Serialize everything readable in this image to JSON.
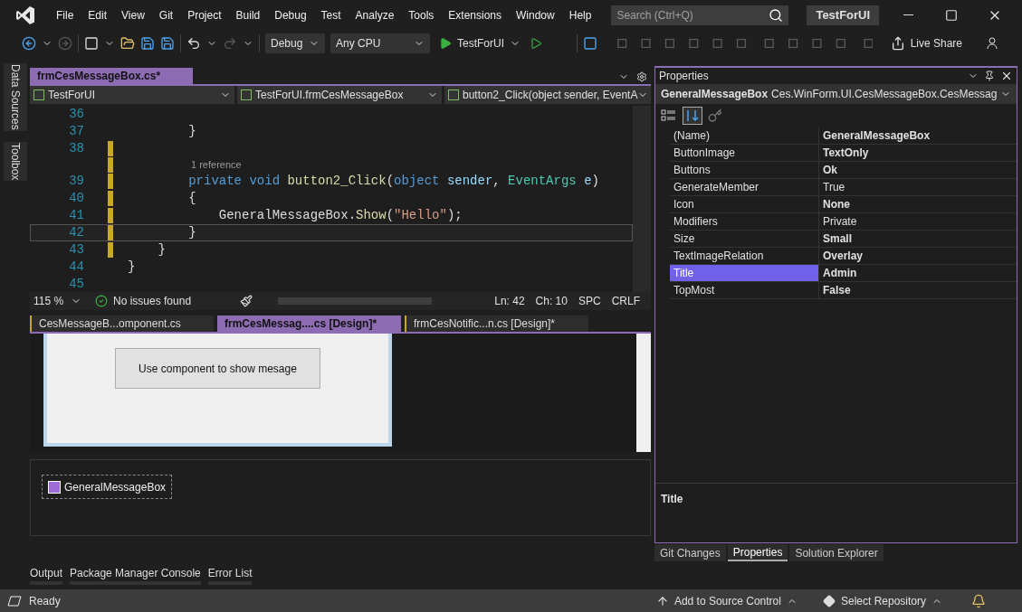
{
  "menu": [
    "File",
    "Edit",
    "View",
    "Git",
    "Project",
    "Build",
    "Debug",
    "Test",
    "Analyze",
    "Tools",
    "Extensions",
    "Window",
    "Help"
  ],
  "search": {
    "placeholder": "Search (Ctrl+Q)"
  },
  "solution_badge": "TestForUI",
  "toolbar": {
    "configuration": "Debug",
    "platform": "Any CPU",
    "start": "TestForUI",
    "live_share": "Live Share"
  },
  "side_tabs": [
    "Data Sources",
    "Toolbox"
  ],
  "editor_tabs": [
    {
      "label": "frmCesMessageBox.cs*",
      "selected": true
    }
  ],
  "nav_bar": [
    "TestForUI",
    "TestForUI.frmCesMessageBox",
    "button2_Click(object sender, EventA"
  ],
  "code_lines": [
    {
      "kind": "line",
      "number": "36",
      "modified": false,
      "current": false
    },
    {
      "kind": "line",
      "number": "37",
      "modified": false,
      "current": false,
      "tokens": [
        {
          "kind": "plain",
          "text": "        }"
        }
      ]
    },
    {
      "kind": "line",
      "number": "38",
      "modified": true,
      "current": false
    },
    {
      "kind": "codelens",
      "text": "1 reference",
      "modified": true
    },
    {
      "kind": "line",
      "number": "39",
      "modified": true,
      "current": false,
      "tokens": [
        {
          "kind": "keyword",
          "text": "        private void "
        },
        {
          "kind": "method",
          "text": "button2_Click"
        },
        {
          "kind": "plain",
          "text": "("
        },
        {
          "kind": "keyword",
          "text": "object "
        },
        {
          "kind": "param",
          "text": "sender"
        },
        {
          "kind": "plain",
          "text": ", "
        },
        {
          "kind": "type",
          "text": "EventArgs "
        },
        {
          "kind": "param",
          "text": "e"
        },
        {
          "kind": "plain",
          "text": ")"
        }
      ]
    },
    {
      "kind": "line",
      "number": "40",
      "modified": true,
      "current": false,
      "tokens": [
        {
          "kind": "plain",
          "text": "        {"
        }
      ]
    },
    {
      "kind": "line",
      "number": "41",
      "modified": true,
      "current": false,
      "tokens": [
        {
          "kind": "plain",
          "text": "            GeneralMessageBox."
        },
        {
          "kind": "method",
          "text": "Show"
        },
        {
          "kind": "plain",
          "text": "("
        },
        {
          "kind": "string",
          "text": "\"Hello\""
        },
        {
          "kind": "plain",
          "text": ");"
        }
      ]
    },
    {
      "kind": "line",
      "number": "42",
      "modified": true,
      "current": true,
      "tokens": [
        {
          "kind": "plain",
          "text": "        }"
        }
      ]
    },
    {
      "kind": "line",
      "number": "43",
      "modified": true,
      "current": false,
      "tokens": [
        {
          "kind": "plain",
          "text": "    }"
        }
      ]
    },
    {
      "kind": "line",
      "number": "44",
      "modified": false,
      "current": false,
      "tokens": [
        {
          "kind": "plain",
          "text": "}"
        }
      ]
    },
    {
      "kind": "line",
      "number": "45",
      "modified": false,
      "current": false
    }
  ],
  "editor_status": {
    "zoom": "115 %",
    "issues": "No issues found",
    "line": "Ln: 42",
    "column": "Ch: 10",
    "whitespace": "SPC",
    "line_endings": "CRLF"
  },
  "document_tabs": [
    {
      "label": "CesMessageB...omponent.cs",
      "selected": false
    },
    {
      "label": "frmCesMessag....cs [Design]*",
      "selected": true
    },
    {
      "label": "frmCesNotific...n.cs [Design]*",
      "selected": false
    }
  ],
  "designer": {
    "form_button": "Use component to show mesage",
    "tray_component": "GeneralMessageBox"
  },
  "bottom_tabs": [
    "Output",
    "Package Manager Console",
    "Error List"
  ],
  "properties": {
    "title": "Properties",
    "object_name": "GeneralMessageBox",
    "object_type": "Ces.WinForm.UI.CesMessageBox.CesMessag",
    "rows": [
      {
        "name": "(Name)",
        "value": "GeneralMessageBox",
        "bold": true,
        "selected": false
      },
      {
        "name": "ButtonImage",
        "value": "TextOnly",
        "bold": true,
        "selected": false
      },
      {
        "name": "Buttons",
        "value": "Ok",
        "bold": true,
        "selected": false
      },
      {
        "name": "GenerateMember",
        "value": "True",
        "bold": false,
        "selected": false
      },
      {
        "name": "Icon",
        "value": "None",
        "bold": true,
        "selected": false
      },
      {
        "name": "Modifiers",
        "value": "Private",
        "bold": false,
        "selected": false
      },
      {
        "name": "Size",
        "value": "Small",
        "bold": true,
        "selected": false
      },
      {
        "name": "TextImageRelation",
        "value": "Overlay",
        "bold": true,
        "selected": false
      },
      {
        "name": "Title",
        "value": "Admin",
        "bold": true,
        "selected": true
      },
      {
        "name": "TopMost",
        "value": "False",
        "bold": true,
        "selected": false
      }
    ],
    "description": "Title"
  },
  "panel_tabs": [
    {
      "label": "Git Changes",
      "selected": false
    },
    {
      "label": "Properties",
      "selected": true
    },
    {
      "label": "Solution Explorer",
      "selected": false
    }
  ],
  "status_bar": {
    "state": "Ready",
    "source_control": "Add to Source Control",
    "repository": "Select Repository"
  }
}
